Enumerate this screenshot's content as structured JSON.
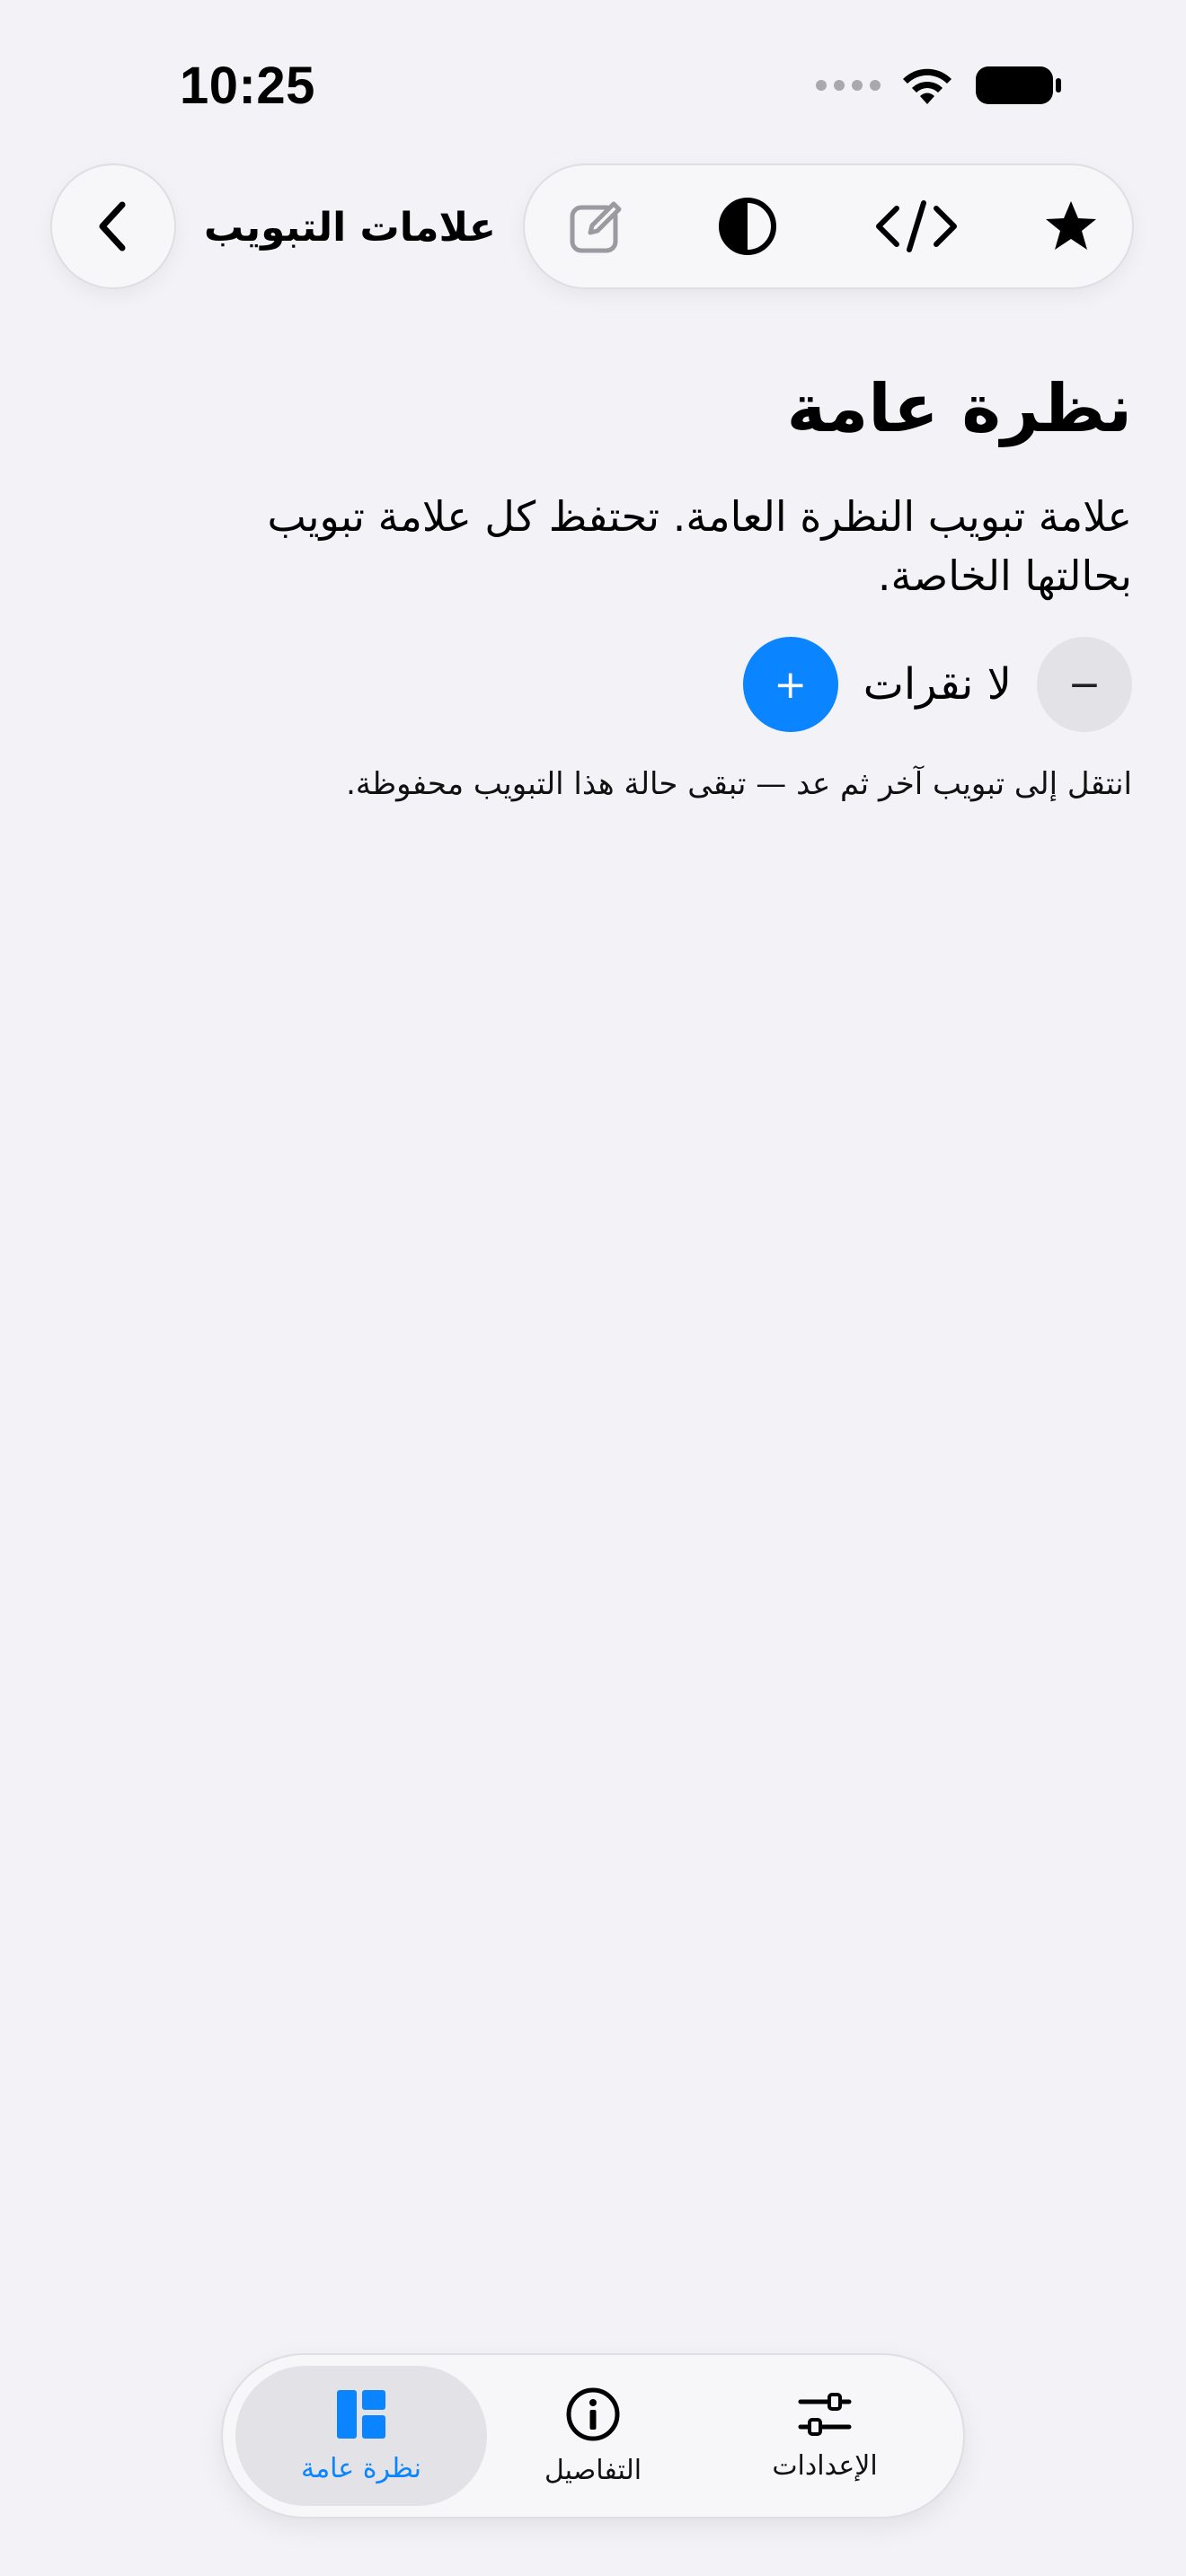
{
  "status_bar": {
    "time": "10:25"
  },
  "nav": {
    "back_icon": "chevron-left-icon",
    "title": "علامات التبويب",
    "tools": [
      "edit-icon",
      "contrast-icon",
      "code-icon",
      "star-icon"
    ]
  },
  "main": {
    "title": "نظرة عامة",
    "description": "علامة تبويب النظرة العامة. تحتفظ كل علامة تبويب بحالتها الخاصة.",
    "counter": {
      "minus_label": "−",
      "value_text": "لا نقرات",
      "plus_label": "+"
    },
    "hint": "انتقل إلى تبويب آخر ثم عد — تبقى حالة هذا التبويب محفوظة."
  },
  "tab_bar": {
    "items": [
      {
        "label": "نظرة عامة",
        "icon": "dashboard-icon",
        "active": true
      },
      {
        "label": "التفاصيل",
        "icon": "info-icon",
        "active": false
      },
      {
        "label": "الإعدادات",
        "icon": "sliders-icon",
        "active": false
      }
    ]
  },
  "colors": {
    "accent": "#0a84ff",
    "background": "#f2f2f7"
  }
}
